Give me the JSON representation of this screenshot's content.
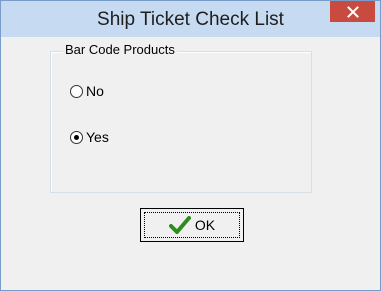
{
  "window": {
    "title": "Ship Ticket Check List",
    "close_glyph": "✕"
  },
  "group": {
    "label": "Bar Code Products",
    "options": [
      {
        "label": "No",
        "checked": false
      },
      {
        "label": "Yes",
        "checked": true
      }
    ]
  },
  "ok_button": {
    "label": "OK",
    "icon": "checkmark-icon"
  },
  "colors": {
    "titlebar": "#c6dbf2",
    "close_button": "#c94a3e",
    "checkmark": "#2e8b1e"
  }
}
